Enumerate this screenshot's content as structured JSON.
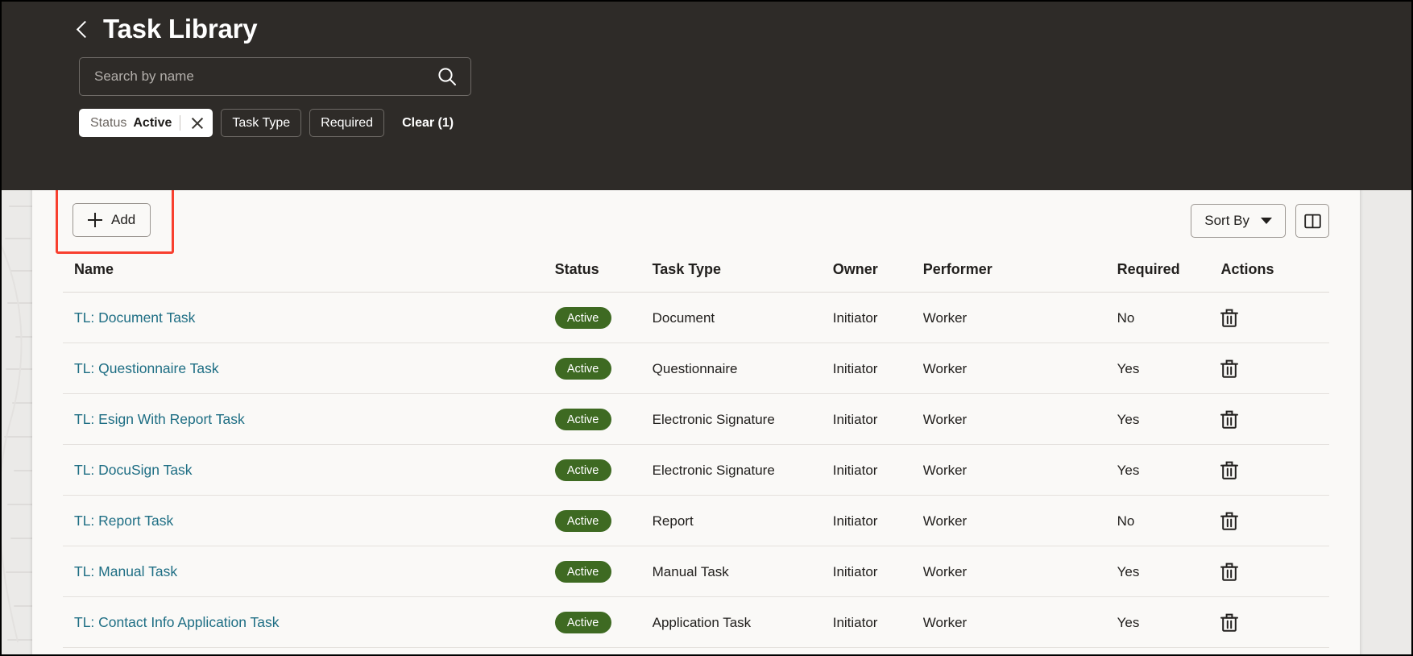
{
  "header": {
    "back_label": "Back",
    "title": "Task Library",
    "search": {
      "placeholder": "Search by name",
      "value": "",
      "icon": "search-icon"
    },
    "filters": {
      "active_chip": {
        "key": "Status",
        "value": "Active",
        "remove_label": "Remove filter"
      },
      "chips": [
        {
          "label": "Task Type"
        },
        {
          "label": "Required"
        }
      ],
      "clear_label": "Clear (1)"
    }
  },
  "toolbar": {
    "add_label": "Add",
    "add_icon": "plus-icon",
    "sort_label": "Sort By",
    "sort_icon": "chevron-down-icon",
    "columns_icon": "columns-layout-icon",
    "highlight_color": "#f8402f"
  },
  "table": {
    "columns": [
      "Name",
      "Status",
      "Task Type",
      "Owner",
      "Performer",
      "Required",
      "Actions"
    ],
    "rows": [
      {
        "name": "TL: Document Task",
        "status": "Active",
        "task_type": "Document",
        "owner": "Initiator",
        "performer": "Worker",
        "required": "No",
        "action_icon": "trash-icon"
      },
      {
        "name": "TL: Questionnaire Task",
        "status": "Active",
        "task_type": "Questionnaire",
        "owner": "Initiator",
        "performer": "Worker",
        "required": "Yes",
        "action_icon": "trash-icon"
      },
      {
        "name": "TL: Esign With Report Task",
        "status": "Active",
        "task_type": "Electronic Signature",
        "owner": "Initiator",
        "performer": "Worker",
        "required": "Yes",
        "action_icon": "trash-icon"
      },
      {
        "name": "TL: DocuSign Task",
        "status": "Active",
        "task_type": "Electronic Signature",
        "owner": "Initiator",
        "performer": "Worker",
        "required": "Yes",
        "action_icon": "trash-icon"
      },
      {
        "name": "TL: Report Task",
        "status": "Active",
        "task_type": "Report",
        "owner": "Initiator",
        "performer": "Worker",
        "required": "No",
        "action_icon": "trash-icon"
      },
      {
        "name": "TL: Manual Task",
        "status": "Active",
        "task_type": "Manual Task",
        "owner": "Initiator",
        "performer": "Worker",
        "required": "Yes",
        "action_icon": "trash-icon"
      },
      {
        "name": "TL: Contact Info Application Task",
        "status": "Active",
        "task_type": "Application Task",
        "owner": "Initiator",
        "performer": "Worker",
        "required": "Yes",
        "action_icon": "trash-icon"
      }
    ]
  },
  "colors": {
    "header_bg": "#2e2b28",
    "card_bg": "#faf9f7",
    "link": "#1e6e84",
    "badge_green": "#3e6a22",
    "highlight_red": "#f8402f"
  }
}
